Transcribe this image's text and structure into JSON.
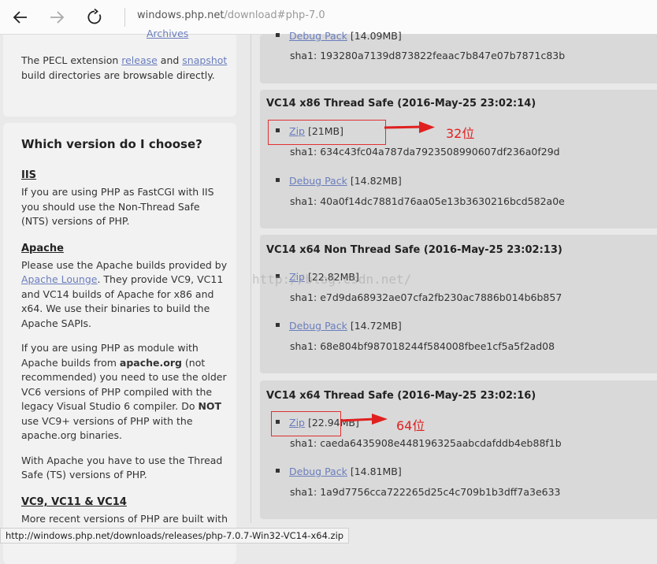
{
  "browser": {
    "address_host": "windows.php.net",
    "address_path": "/download#php-7.0",
    "status_url": "http://windows.php.net/downloads/releases/php-7.0.7-Win32-VC14-x64.zip"
  },
  "left": {
    "top_card": {
      "cut_off_link": "Archives",
      "pecl_p1": "The PECL extension ",
      "pecl_release": "release",
      "pecl_and": " and ",
      "pecl_snapshot": "snapshot",
      "pecl_p2": "build directories are browsable directly."
    },
    "choose": {
      "title": "Which version do I choose?",
      "iis_head": "IIS",
      "iis_lines": [
        "If you are using PHP as FastCGI with IIS",
        "you should use the Non-Thread Safe",
        "(NTS) versions of PHP."
      ],
      "apache_head": "Apache",
      "apache_l1": "Please use the Apache builds provided by",
      "apache_lounge": "Apache Lounge",
      "apache_l2_rest": ". They provide VC9, VC11",
      "apache_l3": "and VC14 builds of Apache for x86 and",
      "apache_l4": "x64. We use their binaries to build the",
      "apache_l5": "Apache SAPIs.",
      "module_l1": "If you are using PHP as module with",
      "module_l2a": "Apache builds from ",
      "module_l2b": "apache.org",
      "module_l2c": " (not",
      "module_l3": "recommended) you need to use the older",
      "module_l4": "VC6 versions of PHP compiled with the",
      "module_l5a": "legacy Visual Studio 6 compiler. Do ",
      "module_l5b": "NOT",
      "module_l6": "use VC9+ versions of PHP with the",
      "module_l7": "apache.org binaries.",
      "ts_l1": "With Apache you have to use the Thread",
      "ts_l2": "Safe (TS) versions of PHP.",
      "vc_head": "VC9, VC11 & VC14",
      "vc_l1": "More recent versions of PHP are built with"
    }
  },
  "downloads": {
    "top": {
      "debug_label": "Debug Pack",
      "debug_size": "[14.09MB]",
      "debug_sha": "sha1: 193280a7139d873822feaac7b847e07b7871c83b"
    },
    "panels": [
      {
        "title": "VC14 x86 Thread Safe (2016-May-25 23:02:14)",
        "zip_label": "Zip",
        "zip_size": "[21MB]",
        "zip_sha": "sha1: 634c43fc04a787da7923508990607df236a0f29d",
        "debug_label": "Debug Pack",
        "debug_size": "[14.82MB]",
        "debug_sha": "sha1: 40a0f14dc7881d76aa05e13b3630216bcd582a0e"
      },
      {
        "title": "VC14 x64 Non Thread Safe (2016-May-25 23:02:13)",
        "zip_label": "Zip",
        "zip_size": "[22.82MB]",
        "zip_sha": "sha1: e7d9da68932ae07cfa2fb230ac7886b014b6b857",
        "debug_label": "Debug Pack",
        "debug_size": "[14.72MB]",
        "debug_sha": "sha1: 68e804bf987018244f584008fbee1cf5a5f2ad08"
      },
      {
        "title": "VC14 x64 Thread Safe (2016-May-25 23:02:16)",
        "zip_label": "Zip",
        "zip_size": "[22.94MB]",
        "zip_sha": "sha1: caeda6435908e448196325aabcdafddb4eb88f1b",
        "debug_label": "Debug Pack",
        "debug_size": "[14.81MB]",
        "debug_sha": "sha1: 1a9d7756cca722265d25c4c709b1b3dff7a3e633"
      }
    ]
  },
  "annotations": {
    "x86_label": "32位",
    "x64_label": "64位",
    "watermark": "http://blog.csdn.net/",
    "color": "#e02020"
  }
}
